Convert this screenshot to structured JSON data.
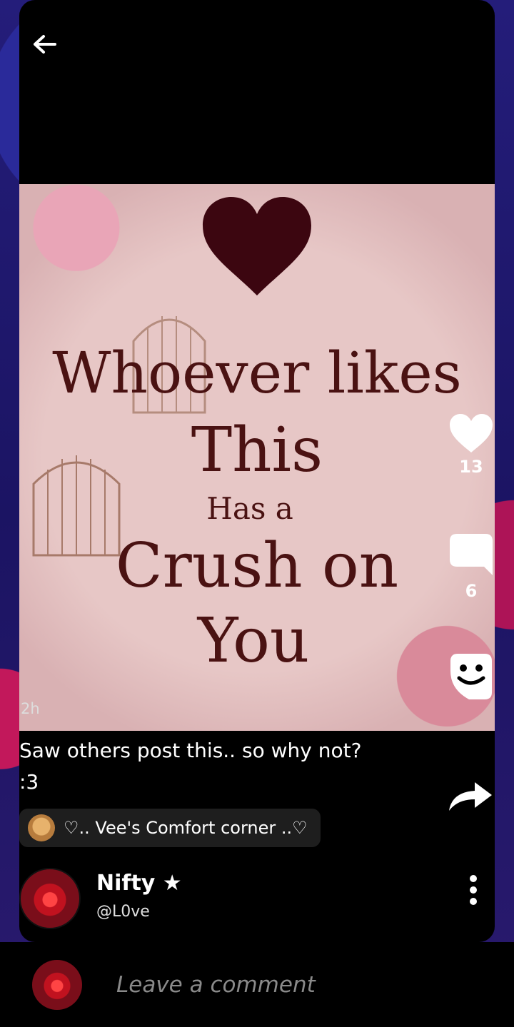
{
  "post": {
    "image_text": {
      "line1": "Whoever likes",
      "line2": "This",
      "line3": "Has a",
      "line4": "Crush on",
      "line5": "You"
    },
    "time_ago": "2h",
    "caption_line1": "Saw others post this.. so why not?",
    "caption_line2": ":3",
    "likes": "13",
    "comments": "6",
    "community": "♡.. Vee's Comfort corner ..♡",
    "author": {
      "name": "Nifty ★",
      "handle": "@L0ve"
    }
  },
  "comment_bar": {
    "placeholder": "Leave a comment"
  },
  "icons": {
    "back": "arrow-left-icon",
    "like": "heart-icon",
    "comment": "speech-bubble-icon",
    "sticker": "sticker-icon",
    "share": "share-arrow-icon",
    "more": "more-vertical-icon"
  },
  "colors": {
    "background": "#1b1463",
    "card": "#000000",
    "quote_text": "#4a1212",
    "placeholder": "#8a8a8a"
  }
}
